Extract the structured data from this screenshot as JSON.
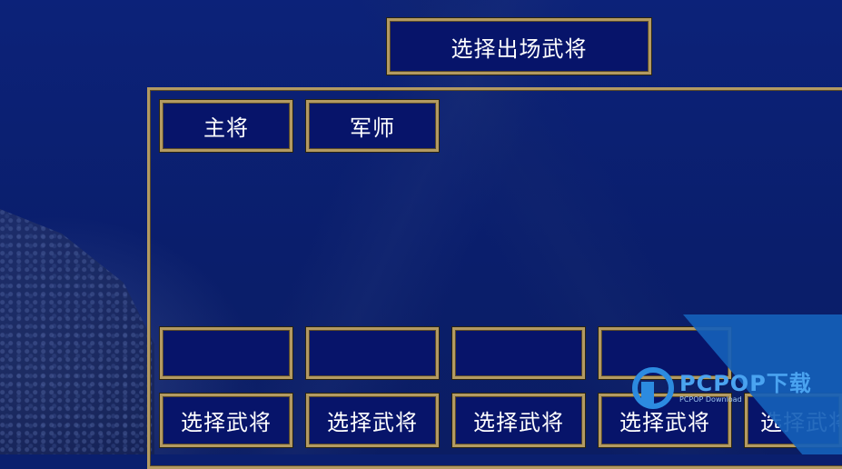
{
  "header": {
    "title": "选择出场武将"
  },
  "roles": {
    "main_general": "主将",
    "strategist": "军师"
  },
  "slots": [
    {
      "name": "",
      "select_label": "选择武将"
    },
    {
      "name": "",
      "select_label": "选择武将"
    },
    {
      "name": "",
      "select_label": "选择武将"
    },
    {
      "name": "",
      "select_label": "选择武将"
    },
    {
      "name": "",
      "select_label": "选择武将"
    }
  ],
  "watermark": {
    "brand": "PCPOP下载",
    "sub": "PCPOP Download"
  },
  "colors": {
    "background": "#0a1f6e",
    "box_fill": "#07146a",
    "gold_border": "#b39a62",
    "watermark_blue": "#1560b8"
  }
}
